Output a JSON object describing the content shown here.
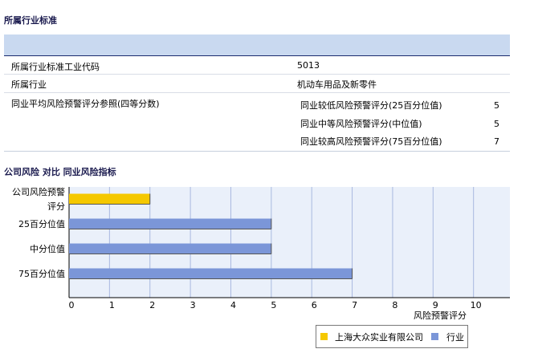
{
  "sections": {
    "industry_title": "所属行业标准",
    "compare_title": "公司风险 对比 同业风险指标"
  },
  "table": {
    "rows": [
      {
        "label": "所属行业标准工业代码",
        "value": "5013"
      },
      {
        "label": "所属行业",
        "value": "机动车用品及新零件"
      }
    ],
    "peer": {
      "label": "同业平均风险预警评分参照(四等分数)",
      "items": [
        {
          "label": "同业较低风险预警评分(25百分位值)",
          "value": "5"
        },
        {
          "label": "同业中等风险预警评分(中位值)",
          "value": "5"
        },
        {
          "label": "同业较高风险预警评分(75百分位值)",
          "value": "7"
        }
      ]
    }
  },
  "colors": {
    "company": "#f5c800",
    "industry": "#7b96d8",
    "plot_bg": "#eaf0fa",
    "grid": "#a9b9e0"
  },
  "chart_data": {
    "type": "bar",
    "orientation": "horizontal",
    "categories": [
      "公司风险预警评分",
      "25百分位值",
      "中分位值",
      "75百分位值"
    ],
    "category_labels": [
      [
        "公司风险预警",
        "评分"
      ],
      [
        "25百分位值"
      ],
      [
        "中分位值"
      ],
      [
        "75百分位值"
      ]
    ],
    "series": [
      {
        "name": "上海大众实业有限公司",
        "values": [
          2,
          null,
          null,
          null
        ],
        "color": "#f5c800"
      },
      {
        "name": "行业",
        "values": [
          null,
          5,
          5,
          7
        ],
        "color": "#7b96d8"
      }
    ],
    "xlabel": "风险预警评分",
    "xlim": [
      0,
      10.9
    ],
    "xticks": [
      "0",
      "1",
      "2",
      "3",
      "4",
      "5",
      "6",
      "7",
      "8",
      "9",
      "10"
    ],
    "grid": true,
    "legend_position": "bottom-right"
  }
}
